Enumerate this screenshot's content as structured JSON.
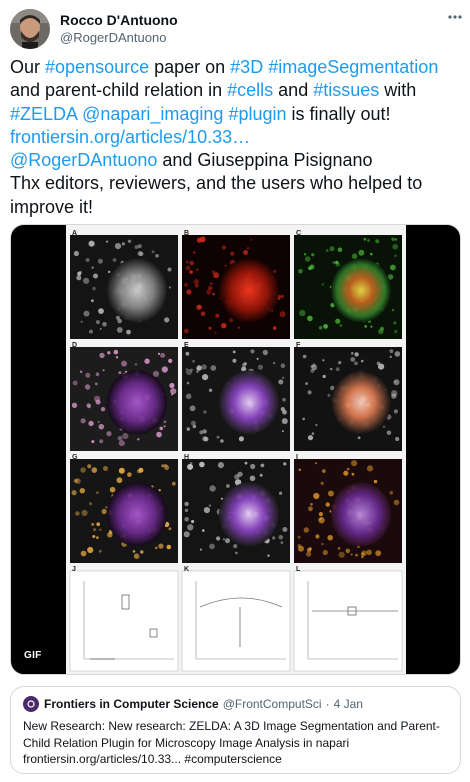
{
  "tweet": {
    "display_name": "Rocco D'Antuono",
    "handle": "@RogerDAntuono",
    "more_icon": "more-dots-icon",
    "body": [
      [
        {
          "t": "Our ",
          "link": false
        },
        {
          "t": "#opensource",
          "link": true
        },
        {
          "t": " paper on ",
          "link": false
        },
        {
          "t": "#3D",
          "link": true
        },
        {
          "t": " ",
          "link": false
        },
        {
          "t": "#imageSegmentation",
          "link": true
        }
      ],
      [
        {
          "t": "and parent-child relation in ",
          "link": false
        },
        {
          "t": "#cells",
          "link": true
        },
        {
          "t": " and ",
          "link": false
        },
        {
          "t": "#tissues",
          "link": true
        },
        {
          "t": " with",
          "link": false
        }
      ],
      [
        {
          "t": "#ZELDA",
          "link": true
        },
        {
          "t": " ",
          "link": false
        },
        {
          "t": "@napari_imaging",
          "link": true
        },
        {
          "t": "  ",
          "link": false
        },
        {
          "t": "#plugin",
          "link": true
        },
        {
          "t": " is finally out!",
          "link": false
        }
      ],
      [
        {
          "t": "frontiersin.org/articles/10.33…",
          "link": true
        }
      ],
      [
        {
          "t": "@RogerDAntuono",
          "link": true
        },
        {
          "t": " and Giuseppina Pisignano",
          "link": false
        }
      ],
      [
        {
          "t": "Thx editors, reviewers, and the users who helped to",
          "link": false
        }
      ],
      [
        {
          "t": "improve it!",
          "link": false
        }
      ]
    ]
  },
  "media": {
    "gif_label": "GIF",
    "panel_letters": [
      "A",
      "B",
      "C",
      "D",
      "E",
      "F",
      "G",
      "H",
      "I",
      "J",
      "K",
      "L"
    ]
  },
  "quote": {
    "name": "Frontiers in Computer Science",
    "handle": "@FrontComputSci",
    "separator": "·",
    "date": "4 Jan",
    "text_lines": [
      "New Research: New research: ZELDA: A 3D Image Segmentation and Parent-",
      "Child Relation Plugin for Microscopy Image Analysis in napari",
      "frontiersin.org/articles/10.33... #computerscience"
    ]
  },
  "colors": {
    "text": "#0f1419",
    "secondary": "#536471",
    "link": "#1d9bf0",
    "border": "#cfd9de"
  }
}
